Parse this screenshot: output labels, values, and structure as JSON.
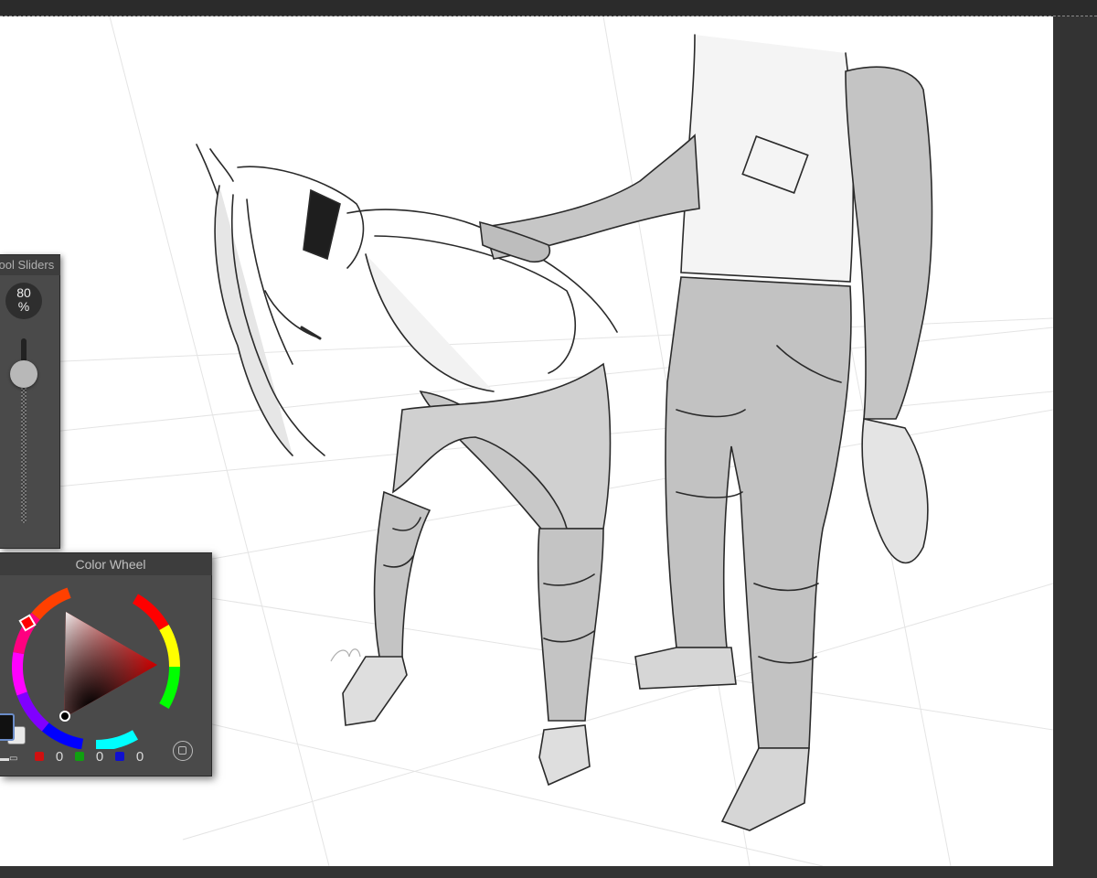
{
  "tool_sliders": {
    "title": "Tool Sliders",
    "size_value": "80",
    "size_unit": "%",
    "opacity_level": 0.85
  },
  "color_wheel": {
    "title": "Color Wheel",
    "red": "0",
    "green": "0",
    "blue": "0",
    "primary_color": "#000000",
    "secondary_color": "#e8e8e8",
    "hue_marker_color": "#ff0000"
  },
  "colors": {
    "workspace_bg": "#3a3a3a",
    "panel_bg": "#4a4a4a",
    "canvas_bg": "#ffffff",
    "red_chip": "#d01010",
    "green_chip": "#10a010",
    "blue_chip": "#1010d0"
  },
  "icons": {
    "swap": "swap-colors-icon",
    "settings": "wheel-settings-icon"
  }
}
